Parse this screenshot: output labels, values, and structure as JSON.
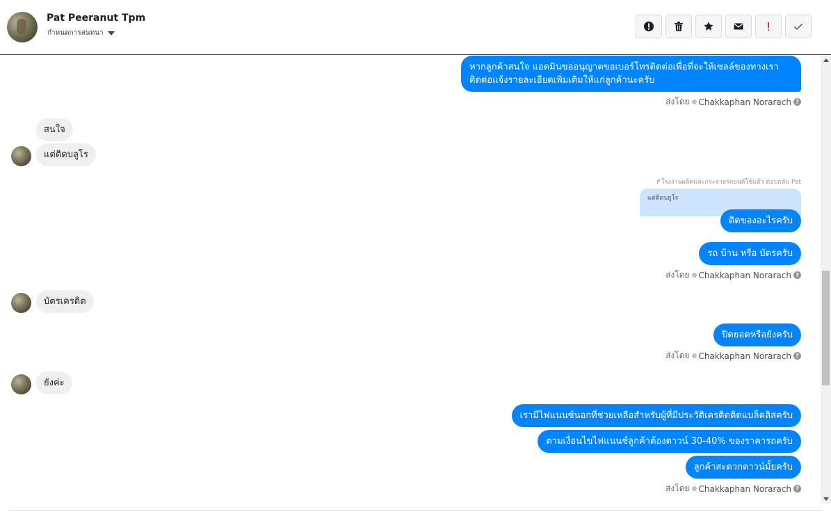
{
  "header": {
    "name": "Pat Peeranut Tpm",
    "subtitle": "กำหนดการสนทนา",
    "toolbar": [
      {
        "icon": "alert-circle-icon",
        "color": "#1c1e21"
      },
      {
        "icon": "trash-icon",
        "color": "#1c1e21"
      },
      {
        "icon": "star-icon",
        "color": "#1c1e21"
      },
      {
        "icon": "envelope-icon",
        "color": "#1c1e21"
      },
      {
        "icon": "exclamation-icon",
        "color": "#e02020"
      },
      {
        "icon": "check-icon",
        "color": "#606770"
      }
    ]
  },
  "messages": {
    "m1": "หากลูกค้าสนใจ แอดมินขออนุญาตขอเบอร์โทรติดต่อเพื่อที่จะให้เซลล์ของทางเราติดต่อแจ้งรายละเอียดเพิ่มเติมให้แก่ลูกค้านะครับ",
    "m2": "สนใจ",
    "m3": "แต่ติดบลูโร",
    "reply_note": "โรงงานผลิตและกระจายรถยนต์ใช้แล้ว ตอบกลับ Pat",
    "quoted": "แต่ติดบลูโร",
    "m4": "ติดของอะไรครับ",
    "m5": "รถ บ้าน หรือ บัตรครับ",
    "m6": "บัตรเครดิต",
    "m7": "ปิดยอดหรือยังครับ",
    "m8": "ยังค่ะ",
    "m9": "เรามีไฟแนนซ์นอกที่ช่วยเหลือสำหรับผู้ที่มีประวัติเครดิตติดแบล็คลิสครับ",
    "m10": "ตามเงื่อนไขไฟแนนซ์ลูกค้าต้องดาวน์ 30-40% ของราคารถครับ",
    "m11": "ลูกค้าสะดวกดาวน์มั้ยครับ"
  },
  "sent_by": {
    "prefix": "ส่งโดย",
    "agent": "Chakkaphan Norarach",
    "help": "?"
  },
  "colors": {
    "outgoing": "#0084ff",
    "incoming": "#f1f0f0",
    "quoted": "#cce4ff"
  }
}
